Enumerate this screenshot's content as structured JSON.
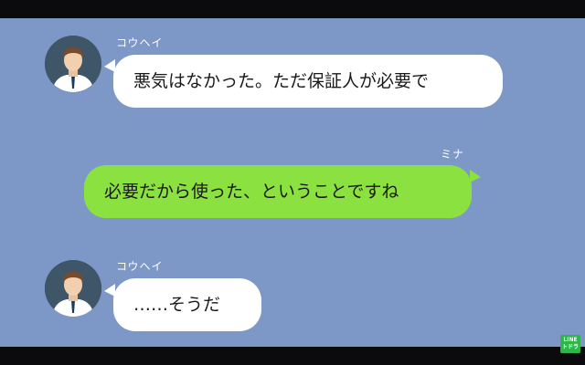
{
  "messages": [
    {
      "sender": "コウヘイ",
      "side": "left",
      "text": "悪気はなかった。ただ保証人が必要で"
    },
    {
      "sender": "ミナ",
      "side": "right",
      "text": "必要だから使った、ということですね"
    },
    {
      "sender": "コウヘイ",
      "side": "left",
      "text": "……そうだ"
    }
  ],
  "logo": {
    "line1": "LINE",
    "line2": "トドラ"
  },
  "colors": {
    "chat_bg": "#7d97c6",
    "green_bubble": "#8be13f",
    "white_bubble": "#ffffff"
  },
  "icons": {
    "avatar": "man-avatar-icon",
    "logo": "line-drama-logo-icon"
  }
}
